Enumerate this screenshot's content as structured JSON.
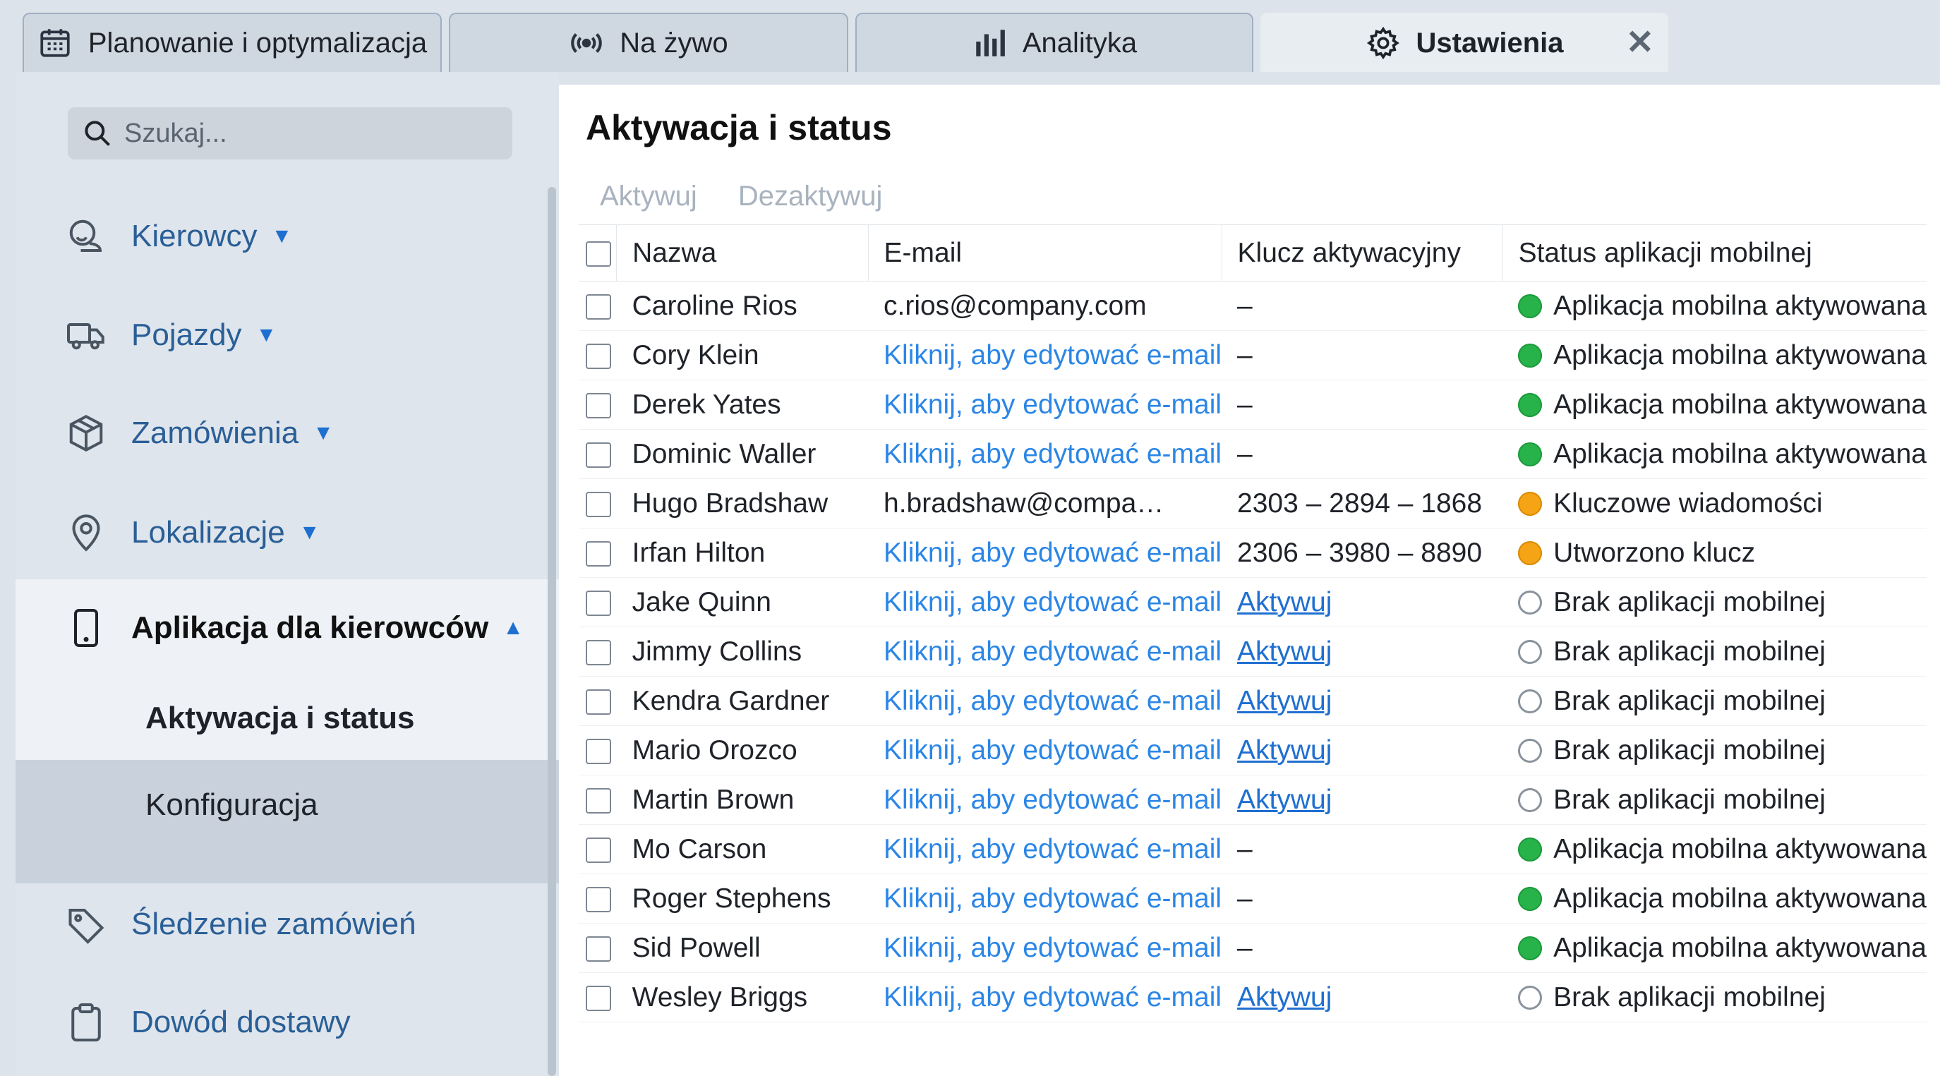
{
  "tabs": [
    {
      "label": "Planowanie i optymalizacja",
      "icon": "calendar-icon"
    },
    {
      "label": "Na żywo",
      "icon": "live-broadcast-icon"
    },
    {
      "label": "Analityka",
      "icon": "bar-chart-icon"
    },
    {
      "label": "Ustawienia",
      "icon": "gear-icon",
      "active": true
    }
  ],
  "sidebar": {
    "search_placeholder": "Szukaj...",
    "items": [
      {
        "label": "Kierowcy",
        "icon": "drivers-icon"
      },
      {
        "label": "Pojazdy",
        "icon": "truck-icon"
      },
      {
        "label": "Zamówienia",
        "icon": "box-icon"
      },
      {
        "label": "Lokalizacje",
        "icon": "location-pin-icon"
      },
      {
        "label": "Aplikacja dla kierowców",
        "icon": "phone-icon",
        "expanded": true
      },
      {
        "label": "Śledzenie zamówień",
        "icon": "tag-icon"
      },
      {
        "label": "Dowód dostawy",
        "icon": "clipboard-icon"
      }
    ],
    "subitems": [
      {
        "label": "Aktywacja i status",
        "active": true
      },
      {
        "label": "Konfiguracja"
      }
    ]
  },
  "main": {
    "title": "Aktywacja i status",
    "actions": {
      "activate": "Aktywuj",
      "deactivate": "Dezaktywuj"
    },
    "columns": [
      "Nazwa",
      "E-mail",
      "Klucz aktywacyjny",
      "Status aplikacji mobilnej"
    ],
    "rows": [
      {
        "name": "Caroline Rios",
        "email": "c.rios@company.com",
        "email_is_link": false,
        "key": "–",
        "key_is_link": false,
        "status": "Aplikacja mobilna aktywowana",
        "status_color": "green"
      },
      {
        "name": "Cory Klein",
        "email": "Kliknij, aby edytować e-mail",
        "email_is_link": true,
        "key": "–",
        "key_is_link": false,
        "status": "Aplikacja mobilna aktywowana",
        "status_color": "green"
      },
      {
        "name": "Derek Yates",
        "email": "Kliknij, aby edytować e-mail",
        "email_is_link": true,
        "key": "–",
        "key_is_link": false,
        "status": "Aplikacja mobilna aktywowana",
        "status_color": "green"
      },
      {
        "name": "Dominic Waller",
        "email": "Kliknij, aby edytować e-mail",
        "email_is_link": true,
        "key": "–",
        "key_is_link": false,
        "status": "Aplikacja mobilna aktywowana",
        "status_color": "green"
      },
      {
        "name": "Hugo Bradshaw",
        "email": "h.bradshaw@compa…",
        "email_is_link": false,
        "key": "2303 – 2894 – 1868",
        "key_is_link": false,
        "status": "Kluczowe wiadomości",
        "status_color": "orange"
      },
      {
        "name": "Irfan Hilton",
        "email": "Kliknij, aby edytować e-mail",
        "email_is_link": true,
        "key": "2306 – 3980 – 8890",
        "key_is_link": false,
        "status": "Utworzono klucz",
        "status_color": "orange"
      },
      {
        "name": "Jake Quinn",
        "email": "Kliknij, aby edytować e-mail",
        "email_is_link": true,
        "key": "Aktywuj",
        "key_is_link": true,
        "status": "Brak aplikacji mobilnej",
        "status_color": "none"
      },
      {
        "name": "Jimmy Collins",
        "email": "Kliknij, aby edytować e-mail",
        "email_is_link": true,
        "key": "Aktywuj",
        "key_is_link": true,
        "status": "Brak aplikacji mobilnej",
        "status_color": "none"
      },
      {
        "name": "Kendra Gardner",
        "email": "Kliknij, aby edytować e-mail",
        "email_is_link": true,
        "key": "Aktywuj",
        "key_is_link": true,
        "status": "Brak aplikacji mobilnej",
        "status_color": "none"
      },
      {
        "name": "Mario Orozco",
        "email": "Kliknij, aby edytować e-mail",
        "email_is_link": true,
        "key": "Aktywuj",
        "key_is_link": true,
        "status": "Brak aplikacji mobilnej",
        "status_color": "none"
      },
      {
        "name": "Martin Brown",
        "email": "Kliknij, aby edytować e-mail",
        "email_is_link": true,
        "key": "Aktywuj",
        "key_is_link": true,
        "status": "Brak aplikacji mobilnej",
        "status_color": "none"
      },
      {
        "name": "Mo Carson",
        "email": "Kliknij, aby edytować e-mail",
        "email_is_link": true,
        "key": "–",
        "key_is_link": false,
        "status": "Aplikacja mobilna aktywowana",
        "status_color": "green"
      },
      {
        "name": "Roger Stephens",
        "email": "Kliknij, aby edytować e-mail",
        "email_is_link": true,
        "key": "–",
        "key_is_link": false,
        "status": "Aplikacja mobilna aktywowana",
        "status_color": "green"
      },
      {
        "name": "Sid Powell",
        "email": "Kliknij, aby edytować e-mail",
        "email_is_link": true,
        "key": "–",
        "key_is_link": false,
        "status": "Aplikacja mobilna aktywowana",
        "status_color": "green"
      },
      {
        "name": "Wesley Briggs",
        "email": "Kliknij, aby edytować e-mail",
        "email_is_link": true,
        "key": "Aktywuj",
        "key_is_link": true,
        "status": "Brak aplikacji mobilnej",
        "status_color": "none"
      }
    ]
  },
  "colors": {
    "link": "#2b86e6",
    "accent": "#1f6fd1",
    "green": "#27b24a",
    "orange": "#f5a416"
  }
}
